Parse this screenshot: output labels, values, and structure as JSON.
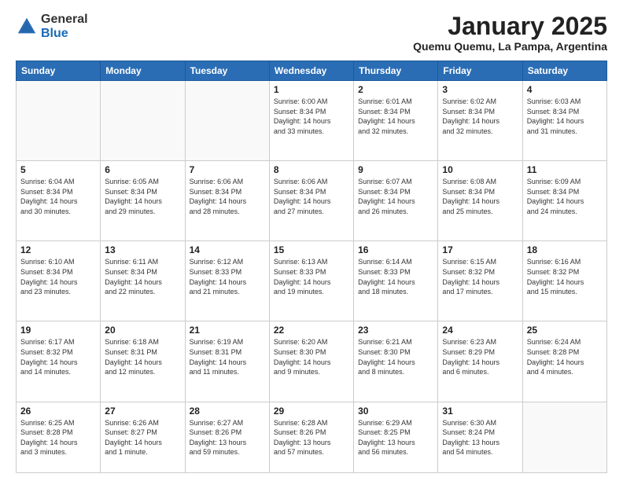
{
  "logo": {
    "general": "General",
    "blue": "Blue"
  },
  "header": {
    "title": "January 2025",
    "subtitle": "Quemu Quemu, La Pampa, Argentina"
  },
  "weekdays": [
    "Sunday",
    "Monday",
    "Tuesday",
    "Wednesday",
    "Thursday",
    "Friday",
    "Saturday"
  ],
  "weeks": [
    [
      {
        "day": "",
        "info": ""
      },
      {
        "day": "",
        "info": ""
      },
      {
        "day": "",
        "info": ""
      },
      {
        "day": "1",
        "info": "Sunrise: 6:00 AM\nSunset: 8:34 PM\nDaylight: 14 hours\nand 33 minutes."
      },
      {
        "day": "2",
        "info": "Sunrise: 6:01 AM\nSunset: 8:34 PM\nDaylight: 14 hours\nand 32 minutes."
      },
      {
        "day": "3",
        "info": "Sunrise: 6:02 AM\nSunset: 8:34 PM\nDaylight: 14 hours\nand 32 minutes."
      },
      {
        "day": "4",
        "info": "Sunrise: 6:03 AM\nSunset: 8:34 PM\nDaylight: 14 hours\nand 31 minutes."
      }
    ],
    [
      {
        "day": "5",
        "info": "Sunrise: 6:04 AM\nSunset: 8:34 PM\nDaylight: 14 hours\nand 30 minutes."
      },
      {
        "day": "6",
        "info": "Sunrise: 6:05 AM\nSunset: 8:34 PM\nDaylight: 14 hours\nand 29 minutes."
      },
      {
        "day": "7",
        "info": "Sunrise: 6:06 AM\nSunset: 8:34 PM\nDaylight: 14 hours\nand 28 minutes."
      },
      {
        "day": "8",
        "info": "Sunrise: 6:06 AM\nSunset: 8:34 PM\nDaylight: 14 hours\nand 27 minutes."
      },
      {
        "day": "9",
        "info": "Sunrise: 6:07 AM\nSunset: 8:34 PM\nDaylight: 14 hours\nand 26 minutes."
      },
      {
        "day": "10",
        "info": "Sunrise: 6:08 AM\nSunset: 8:34 PM\nDaylight: 14 hours\nand 25 minutes."
      },
      {
        "day": "11",
        "info": "Sunrise: 6:09 AM\nSunset: 8:34 PM\nDaylight: 14 hours\nand 24 minutes."
      }
    ],
    [
      {
        "day": "12",
        "info": "Sunrise: 6:10 AM\nSunset: 8:34 PM\nDaylight: 14 hours\nand 23 minutes."
      },
      {
        "day": "13",
        "info": "Sunrise: 6:11 AM\nSunset: 8:34 PM\nDaylight: 14 hours\nand 22 minutes."
      },
      {
        "day": "14",
        "info": "Sunrise: 6:12 AM\nSunset: 8:33 PM\nDaylight: 14 hours\nand 21 minutes."
      },
      {
        "day": "15",
        "info": "Sunrise: 6:13 AM\nSunset: 8:33 PM\nDaylight: 14 hours\nand 19 minutes."
      },
      {
        "day": "16",
        "info": "Sunrise: 6:14 AM\nSunset: 8:33 PM\nDaylight: 14 hours\nand 18 minutes."
      },
      {
        "day": "17",
        "info": "Sunrise: 6:15 AM\nSunset: 8:32 PM\nDaylight: 14 hours\nand 17 minutes."
      },
      {
        "day": "18",
        "info": "Sunrise: 6:16 AM\nSunset: 8:32 PM\nDaylight: 14 hours\nand 15 minutes."
      }
    ],
    [
      {
        "day": "19",
        "info": "Sunrise: 6:17 AM\nSunset: 8:32 PM\nDaylight: 14 hours\nand 14 minutes."
      },
      {
        "day": "20",
        "info": "Sunrise: 6:18 AM\nSunset: 8:31 PM\nDaylight: 14 hours\nand 12 minutes."
      },
      {
        "day": "21",
        "info": "Sunrise: 6:19 AM\nSunset: 8:31 PM\nDaylight: 14 hours\nand 11 minutes."
      },
      {
        "day": "22",
        "info": "Sunrise: 6:20 AM\nSunset: 8:30 PM\nDaylight: 14 hours\nand 9 minutes."
      },
      {
        "day": "23",
        "info": "Sunrise: 6:21 AM\nSunset: 8:30 PM\nDaylight: 14 hours\nand 8 minutes."
      },
      {
        "day": "24",
        "info": "Sunrise: 6:23 AM\nSunset: 8:29 PM\nDaylight: 14 hours\nand 6 minutes."
      },
      {
        "day": "25",
        "info": "Sunrise: 6:24 AM\nSunset: 8:28 PM\nDaylight: 14 hours\nand 4 minutes."
      }
    ],
    [
      {
        "day": "26",
        "info": "Sunrise: 6:25 AM\nSunset: 8:28 PM\nDaylight: 14 hours\nand 3 minutes."
      },
      {
        "day": "27",
        "info": "Sunrise: 6:26 AM\nSunset: 8:27 PM\nDaylight: 14 hours\nand 1 minute."
      },
      {
        "day": "28",
        "info": "Sunrise: 6:27 AM\nSunset: 8:26 PM\nDaylight: 13 hours\nand 59 minutes."
      },
      {
        "day": "29",
        "info": "Sunrise: 6:28 AM\nSunset: 8:26 PM\nDaylight: 13 hours\nand 57 minutes."
      },
      {
        "day": "30",
        "info": "Sunrise: 6:29 AM\nSunset: 8:25 PM\nDaylight: 13 hours\nand 56 minutes."
      },
      {
        "day": "31",
        "info": "Sunrise: 6:30 AM\nSunset: 8:24 PM\nDaylight: 13 hours\nand 54 minutes."
      },
      {
        "day": "",
        "info": ""
      }
    ]
  ]
}
